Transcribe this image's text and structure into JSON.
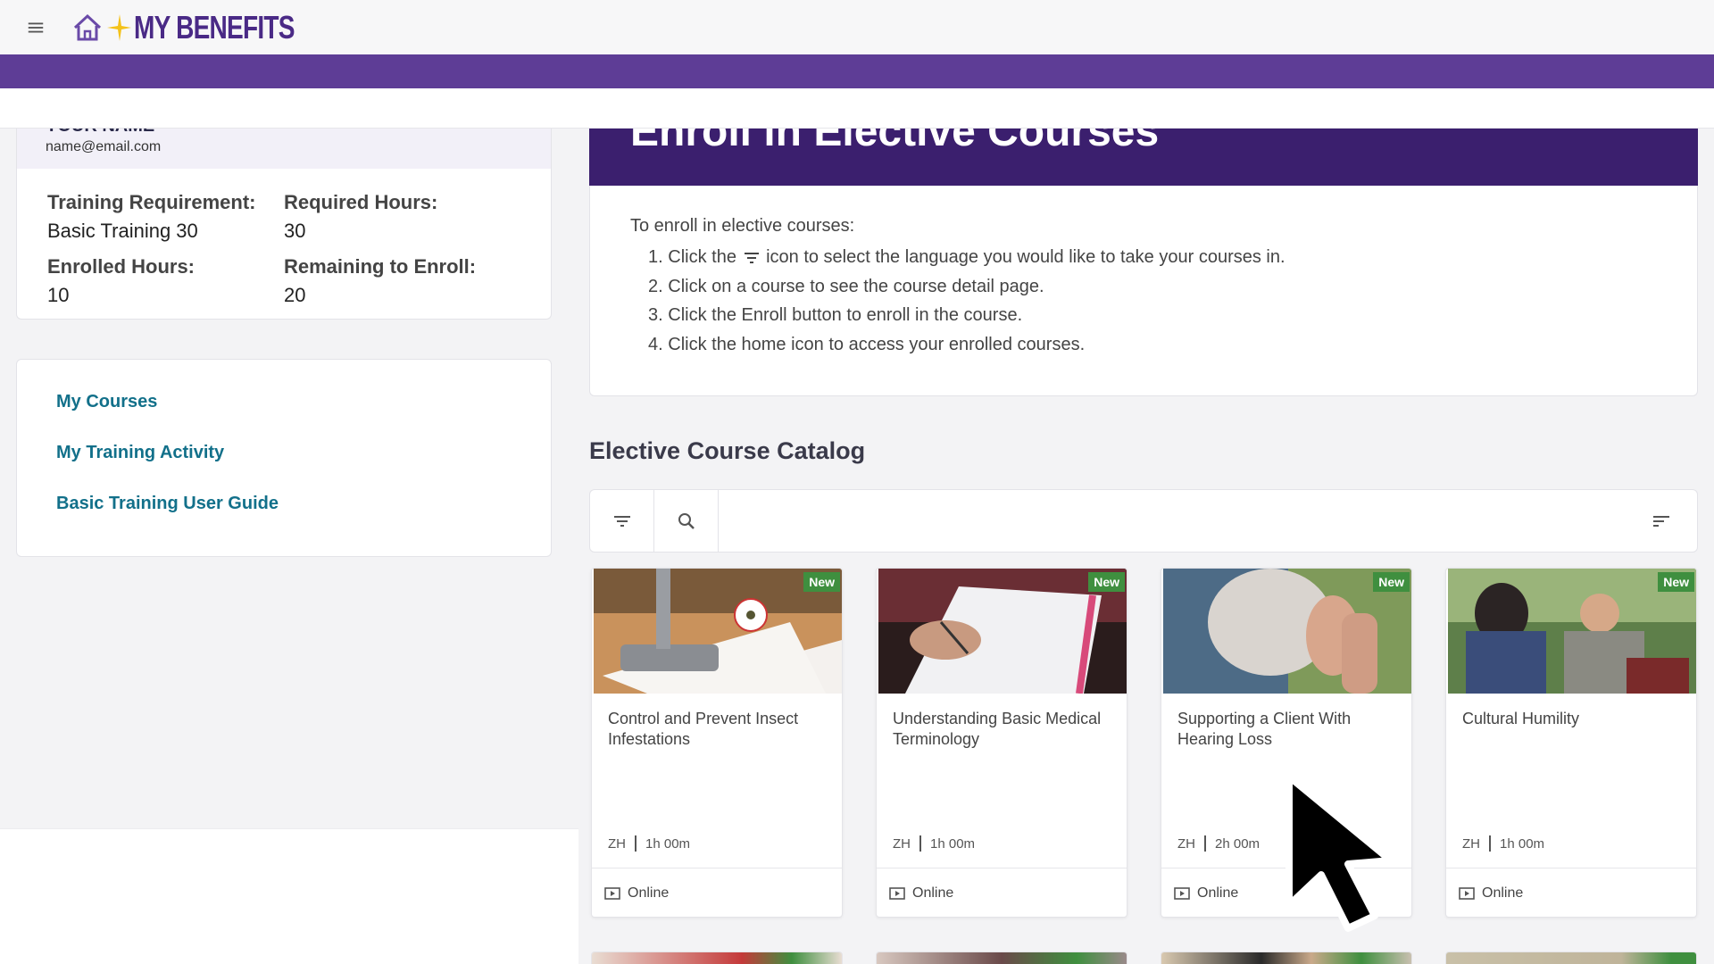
{
  "header": {
    "brand_text": "MY BENEFITS",
    "menu_icon": "hamburger-icon",
    "home_icon": "home-icon"
  },
  "colors": {
    "brand_purple": "#4a2a86",
    "band_purple": "#5e3d96",
    "banner_purple": "#3b1f6e",
    "link_teal": "#12708a",
    "badge_green": "#3f8f3f"
  },
  "profile": {
    "name": "YOUR NAME",
    "email": "name@email.com",
    "stats": [
      {
        "label": "Training Requirement:",
        "value": "Basic Training 30"
      },
      {
        "label": "Required Hours:",
        "value": "30"
      },
      {
        "label": "Enrolled Hours:",
        "value": "10"
      },
      {
        "label": "Remaining to Enroll:",
        "value": "20"
      }
    ]
  },
  "nav_links": [
    "My Courses",
    "My Training Activity",
    "Basic Training User Guide"
  ],
  "main": {
    "banner_title": "Enroll in Elective Courses",
    "intro": "To enroll in elective courses:",
    "steps": [
      {
        "num": "1.",
        "before": "Click the",
        "after": "icon to select the language you would like to take your courses in."
      },
      {
        "num": "2.",
        "text": "Click on a course to see the course detail page."
      },
      {
        "num": "3.",
        "text": "Click the Enroll button to enroll in the course."
      },
      {
        "num": "4.",
        "text": "Click the home icon to access your enrolled courses."
      }
    ],
    "catalog_title": "Elective Course Catalog",
    "toolbar_icons": [
      "filter-icon",
      "search-icon",
      "sort-icon"
    ]
  },
  "courses": [
    {
      "title": "Control and Prevent Insect Infestations",
      "badge": "New",
      "language": "ZH",
      "duration": "1h 00m",
      "format": "Online"
    },
    {
      "title": "Understanding Basic Medical Terminology",
      "badge": "New",
      "language": "ZH",
      "duration": "1h 00m",
      "format": "Online"
    },
    {
      "title": "Supporting a Client With Hearing Loss",
      "badge": "New",
      "language": "ZH",
      "duration": "2h 00m",
      "format": "Online"
    },
    {
      "title": "Cultural Humility",
      "badge": "New",
      "language": "ZH",
      "duration": "1h 00m",
      "format": "Online"
    }
  ]
}
